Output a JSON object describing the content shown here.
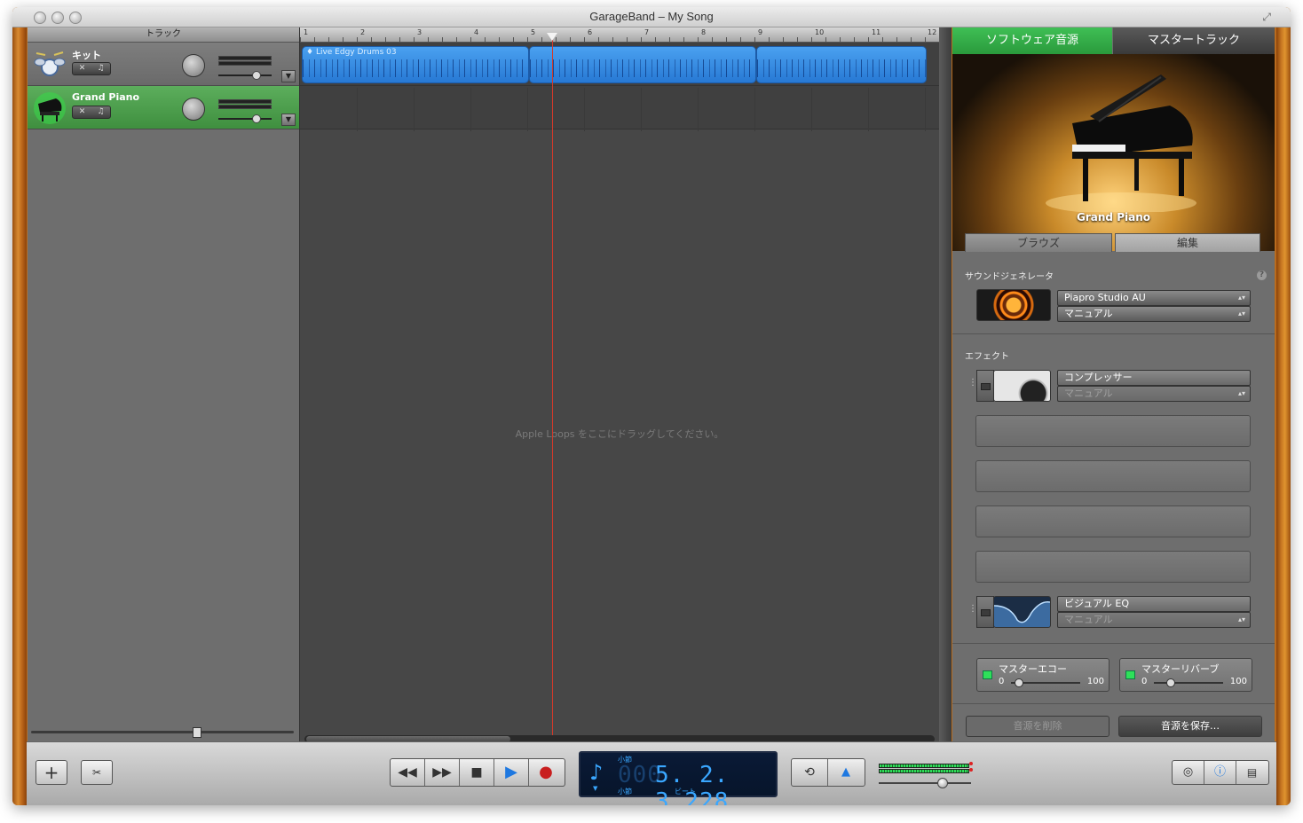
{
  "window": {
    "title": "GarageBand – My Song"
  },
  "tracks_header": "トラック",
  "tracks": [
    {
      "name": "キット",
      "selected": false,
      "icon": "drum-kit-icon"
    },
    {
      "name": "Grand Piano",
      "selected": true,
      "icon": "grand-piano-icon"
    }
  ],
  "timeline": {
    "bars": [
      "1",
      "2",
      "3",
      "4",
      "5",
      "6",
      "7",
      "8",
      "9",
      "10",
      "11",
      "12"
    ],
    "regions": [
      {
        "label": "Live Edgy Drums 03"
      }
    ],
    "drop_hint": "Apple Loops をここにドラッグしてください。",
    "playhead_bar": 5.2
  },
  "right_panel": {
    "tabs": [
      "ソフトウェア音源",
      "マスタートラック"
    ],
    "instrument_name": "Grand Piano",
    "subtabs": [
      "ブラウズ",
      "編集"
    ],
    "sound_generator_label": "サウンドジェネレータ",
    "help": "?",
    "generator": {
      "plugin": "Piapro Studio AU",
      "preset": "マニュアル"
    },
    "effects_label": "エフェクト",
    "effects": [
      {
        "name": "コンプレッサー",
        "preset": "マニュアル"
      },
      {
        "name": "ビジュアル EQ",
        "preset": "マニュアル"
      }
    ],
    "sends": [
      {
        "name": "マスターエコー",
        "min": "0",
        "max": "100"
      },
      {
        "name": "マスターリバーブ",
        "min": "0",
        "max": "100"
      }
    ],
    "delete_button": "音源を削除",
    "save_button": "音源を保存…"
  },
  "transport": {
    "lcd_value": "5. 2. 3.228",
    "lcd_bar_label": "小節",
    "lcd_beat_label": "ビート",
    "lcd_top_label": "小節"
  },
  "colors": {
    "accent_green": "#2fa845",
    "region_blue": "#3a8ee8",
    "playhead": "#d23a2a",
    "lcd": "#3aa7ff"
  }
}
